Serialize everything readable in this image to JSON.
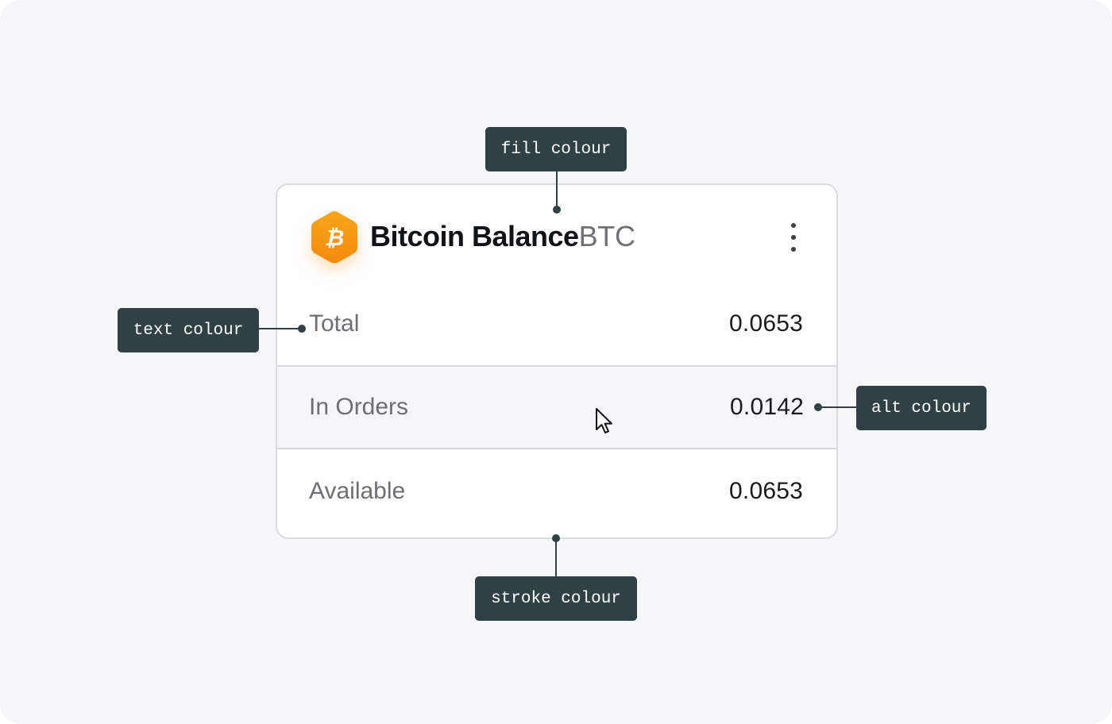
{
  "card": {
    "title": "Bitcoin Balance",
    "ticker": "BTC",
    "coin_icon": "bitcoin-icon",
    "menu_icon": "more-vertical-icon",
    "rows": [
      {
        "label": "Total",
        "value": "0.0653"
      },
      {
        "label": "In Orders",
        "value": "0.0142"
      },
      {
        "label": "Available",
        "value": "0.0653"
      }
    ]
  },
  "annotations": {
    "fill": "fill colour",
    "text": "text colour",
    "alt": "alt colour",
    "stroke": "stroke colour"
  },
  "colors": {
    "background": "#f5f6f8",
    "card_fill": "#ffffff",
    "card_stroke": "#d9dde0",
    "alt_row": "#f5f6f8",
    "text": "#6c6f72",
    "value_text": "#1a1c1e",
    "accent": "#f7931a",
    "tag": "#2f4144"
  }
}
